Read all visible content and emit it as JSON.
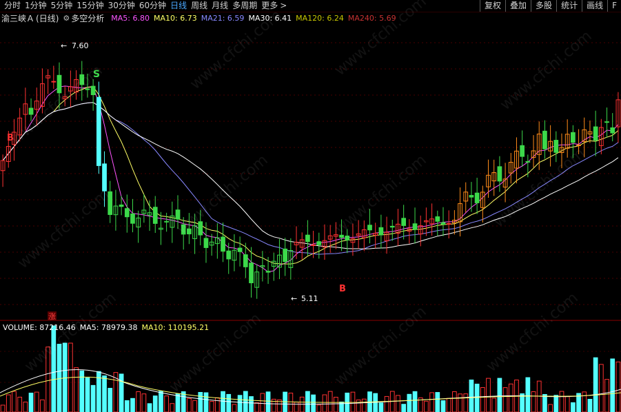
{
  "toolbar": {
    "periods": [
      "分时",
      "1分钟",
      "5分钟",
      "15分钟",
      "30分钟",
      "60分钟",
      "日线",
      "周线",
      "月线",
      "多周期",
      "更多"
    ],
    "active_period": "日线",
    "more_arrow": ">",
    "tools": [
      "复权",
      "叠加",
      "多股",
      "统计",
      "画线",
      "F"
    ]
  },
  "main_indicator": {
    "stock_title": "渝三峡Ａ",
    "period_label": "(日线)",
    "indicator_name": "多空分析",
    "ma_items": [
      {
        "label": "MA5: 6.80",
        "color": "#ff55ff"
      },
      {
        "label": "MA10: 6.73",
        "color": "#ffff66"
      },
      {
        "label": "MA21: 6.59",
        "color": "#8888ff"
      },
      {
        "label": "MA30: 6.41",
        "color": "#ffffff"
      },
      {
        "label": "MA120: 6.24",
        "color": "#c8c800"
      },
      {
        "label": "MA240: 5.69",
        "color": "#c83232"
      }
    ]
  },
  "annotations": {
    "high_label": "7.60",
    "low_label": "5.11",
    "sell_marker": "S",
    "buy_marker_1": "B",
    "buy_marker_2": "B",
    "limit_up": "涨"
  },
  "volume_indicator": {
    "items": [
      {
        "label": "VOLUME: 87216.46",
        "color": "#ffffff"
      },
      {
        "label": "MA5: 78979.38",
        "color": "#ffffff"
      },
      {
        "label": "MA10: 110195.21",
        "color": "#ffff66"
      }
    ]
  },
  "watermark": "www.cfchi.com",
  "colors": {
    "up": "#ff3232",
    "down": "#54ffff",
    "green_candle": "#3cd94a",
    "orange": "#ff8c1a"
  },
  "chart_data": {
    "type": "candlestick",
    "price_high": 7.6,
    "price_low": 5.11,
    "volume": {
      "value": 87216.46,
      "ma5": 78979.38,
      "ma10": 110195.21
    }
  }
}
